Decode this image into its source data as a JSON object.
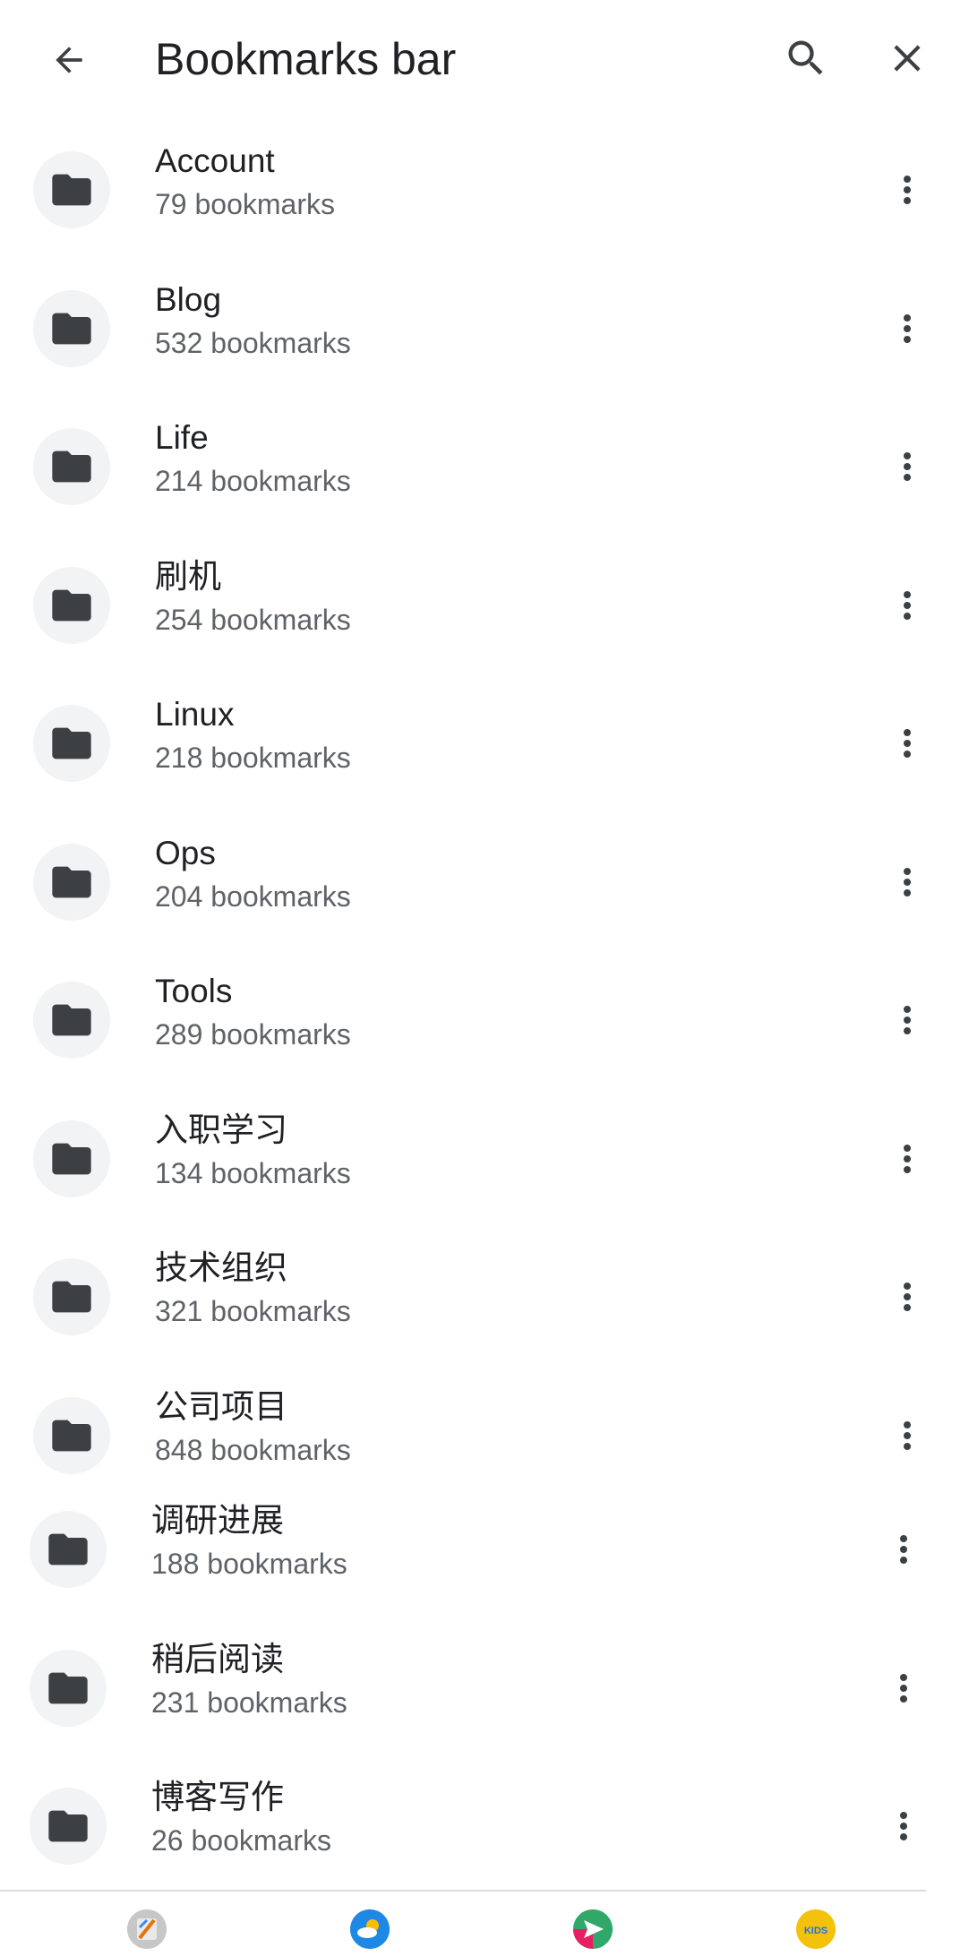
{
  "header": {
    "title": "Bookmarks bar",
    "back_icon": "arrow-back-icon",
    "search_icon": "search-icon",
    "close_icon": "close-icon"
  },
  "folders": [
    {
      "name": "Account",
      "count": "79 bookmarks"
    },
    {
      "name": "Blog",
      "count": "532 bookmarks"
    },
    {
      "name": "Life",
      "count": "214 bookmarks"
    },
    {
      "name": "刷机",
      "count": "254 bookmarks"
    },
    {
      "name": "Linux",
      "count": "218 bookmarks"
    },
    {
      "name": "Ops",
      "count": "204 bookmarks"
    },
    {
      "name": "Tools",
      "count": "289 bookmarks"
    },
    {
      "name": "入职学习",
      "count": "134 bookmarks"
    },
    {
      "name": "技术组织",
      "count": "321 bookmarks"
    },
    {
      "name": "公司项目",
      "count": "848 bookmarks"
    },
    {
      "name": "调研进展",
      "count": "188 bookmarks"
    },
    {
      "name": "稍后阅读",
      "count": "231 bookmarks"
    },
    {
      "name": "博客写作",
      "count": "26 bookmarks"
    }
  ],
  "bottom_apps": [
    {
      "icon": "app-icon-1"
    },
    {
      "icon": "weather-app-icon"
    },
    {
      "icon": "send-app-icon"
    },
    {
      "icon": "kids-app-icon",
      "label": "KIDS"
    }
  ],
  "colors": {
    "text_primary": "#202124",
    "text_secondary": "#5f6368",
    "icon": "#3c4043",
    "folder_bg": "#f1f3f4"
  }
}
